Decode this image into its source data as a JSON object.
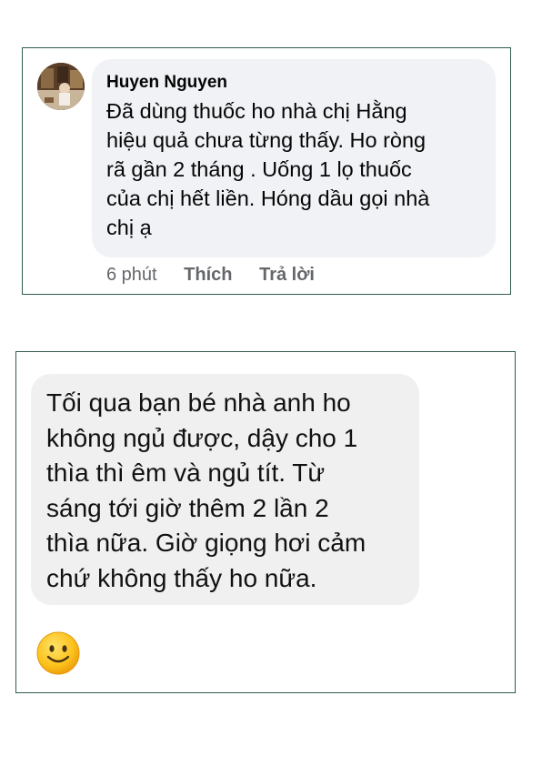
{
  "comment": {
    "author": "Huyen Nguyen",
    "text": "Đã dùng thuốc ho nhà chị Hằng\nhiệu quả chưa từng thấy. Ho ròng\nrã gần 2 tháng . Uống 1 lọ thuốc\ncủa chị hết liền. Hóng dầu gọi nhà\nchị ạ",
    "time": "6 phút",
    "like_label": "Thích",
    "reply_label": "Trả lời"
  },
  "message": {
    "text": "Tối qua bạn bé nhà anh ho\nkhông ngủ được, dậy cho 1\nthìa thì êm và ngủ tít. Từ\nsáng tới giờ thêm 2 lần 2\nthìa nữa. Giờ giọng hơi cảm\nchứ không thấy ho nữa.",
    "reaction_icon": "smiley-face-emoji"
  },
  "colors": {
    "card_border": "#2f5d4f",
    "comment_bubble": "#f0f2f5",
    "message_bubble": "#f0f0f0",
    "secondary_text": "#65676b",
    "emoji_yellow": "#fcc21b"
  }
}
